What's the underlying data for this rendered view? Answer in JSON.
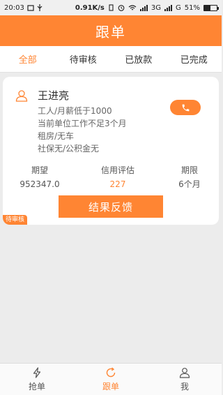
{
  "status_bar": {
    "time": "20:03",
    "speed": "0.91K/s",
    "network_1": "3G",
    "network_2": "G",
    "battery_percent": "51%"
  },
  "header": {
    "title": "跟单"
  },
  "tabs": [
    {
      "label": "全部",
      "active": true
    },
    {
      "label": "待审核",
      "active": false
    },
    {
      "label": "已放款",
      "active": false
    },
    {
      "label": "已完成",
      "active": false
    }
  ],
  "card": {
    "name": "王进亮",
    "info_lines": [
      "工人/月薪低于1000",
      "当前单位工作不足3个月",
      "租房/无车",
      "社保无/公积金无"
    ],
    "stats": {
      "expect_label": "期望",
      "expect_value": "952347.0",
      "credit_label": "信用评估",
      "credit_value": "227",
      "term_label": "期限",
      "term_value": "6个月"
    },
    "feedback_label": "结果反馈",
    "status_tag": "待审核"
  },
  "bottom_nav": [
    {
      "label": "抢单",
      "icon": "lightning-icon",
      "active": false
    },
    {
      "label": "跟单",
      "icon": "refresh-icon",
      "active": true
    },
    {
      "label": "我",
      "icon": "person-icon",
      "active": false
    }
  ],
  "colors": {
    "accent": "#ff8533",
    "background": "#ececec"
  }
}
